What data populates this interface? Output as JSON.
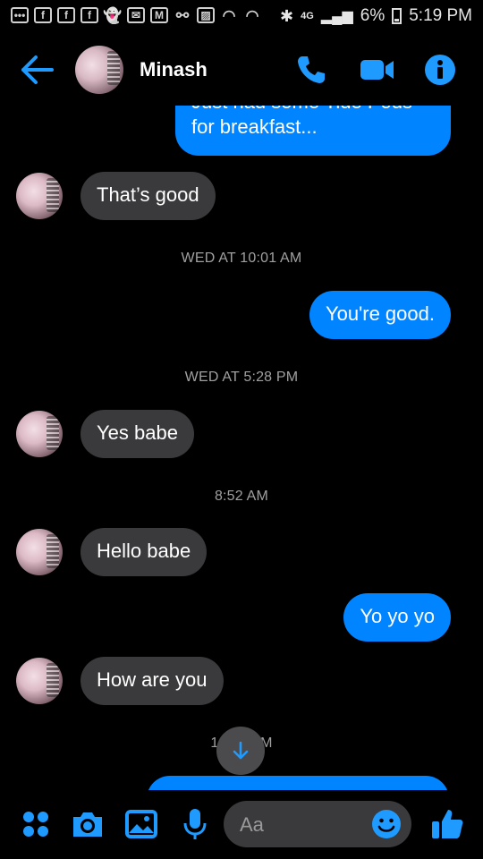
{
  "status_bar": {
    "battery": "6%",
    "time": "5:19 PM",
    "network": "4G"
  },
  "header": {
    "contact_name": "Minash"
  },
  "messages": [
    {
      "side": "out",
      "text_line1": "Just had some Tide Pods",
      "text_line2": "for breakfast..."
    },
    {
      "side": "in",
      "text": "That’s good"
    },
    {
      "type": "timestamp",
      "text": "WED AT 10:01 AM"
    },
    {
      "side": "out",
      "text": "You're good."
    },
    {
      "type": "timestamp",
      "text": "WED AT 5:28 PM"
    },
    {
      "side": "in",
      "text": "Yes babe"
    },
    {
      "type": "timestamp",
      "text": "8:52 AM"
    },
    {
      "side": "in",
      "text": "Hello babe"
    },
    {
      "side": "out",
      "text": "Yo yo yo"
    },
    {
      "side": "in",
      "text": "How are you"
    },
    {
      "type": "timestamp",
      "text": "10:__ AM"
    }
  ],
  "composer": {
    "placeholder": "Aa"
  },
  "colors": {
    "accent": "#0084ff",
    "incoming_bubble": "#3a3a3c",
    "background": "#000000"
  }
}
